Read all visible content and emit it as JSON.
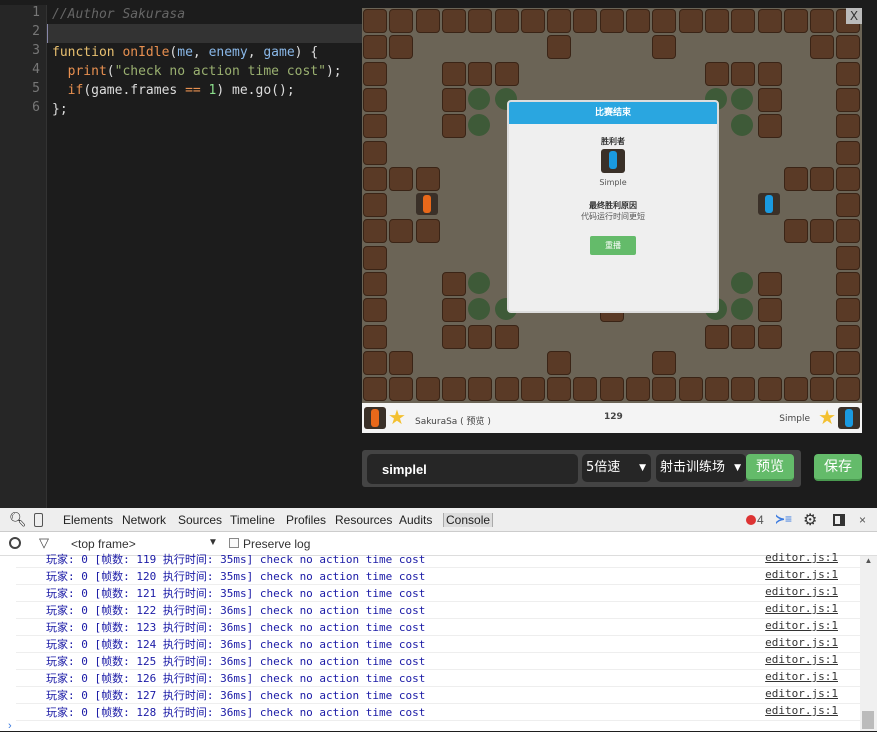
{
  "editor": {
    "line_numbers": [
      "1",
      "2",
      "3",
      "4",
      "5",
      "6"
    ],
    "lines": [
      [
        {
          "t": "//Author Sakurasa",
          "c": "cm"
        }
      ],
      [],
      [
        {
          "t": "function ",
          "c": "kw"
        },
        {
          "t": "onIdle",
          "c": "fn"
        },
        {
          "t": "(",
          "c": ""
        },
        {
          "t": "me",
          "c": "pa"
        },
        {
          "t": ", ",
          "c": ""
        },
        {
          "t": "enemy",
          "c": "pa"
        },
        {
          "t": ", ",
          "c": ""
        },
        {
          "t": "game",
          "c": "pa"
        },
        {
          "t": ") {",
          "c": ""
        }
      ],
      [
        {
          "t": "  ",
          "c": ""
        },
        {
          "t": "print",
          "c": "fn"
        },
        {
          "t": "(",
          "c": ""
        },
        {
          "t": "\"check no action time cost\"",
          "c": "st"
        },
        {
          "t": ");",
          "c": ""
        }
      ],
      [
        {
          "t": "  ",
          "c": ""
        },
        {
          "t": "if",
          "c": "fn"
        },
        {
          "t": "(game.frames ",
          "c": ""
        },
        {
          "t": "==",
          "c": "fn"
        },
        {
          "t": " ",
          "c": ""
        },
        {
          "t": "1",
          "c": "nu"
        },
        {
          "t": ") me.go();",
          "c": ""
        }
      ],
      [
        {
          "t": "};",
          "c": ""
        }
      ]
    ]
  },
  "game": {
    "close": "X",
    "dialog": {
      "title": "比赛结束",
      "winner_label": "胜利者",
      "winner": "Simple",
      "reason_label": "最终胜利原因",
      "reason": "代码运行时间更短",
      "replay": "重播"
    },
    "status": {
      "player1": "SakuraSa ( 预览 )",
      "frame": "129",
      "player2": "Simple"
    },
    "colors": {
      "player1_tank": "#e8681a",
      "player2_tank": "#1a9ae0"
    }
  },
  "controls": {
    "name_value": "simplel",
    "speed": "5倍速",
    "map": "射击训练场",
    "preview": "预览",
    "save": "保存"
  },
  "devtools": {
    "tabs": [
      "Elements",
      "Network",
      "Sources",
      "Timeline",
      "Profiles",
      "Resources",
      "Audits",
      "Console"
    ],
    "active_tab": "Console",
    "error_count": "4",
    "frame": "<top frame>",
    "preserve_log": "Preserve log",
    "logs": [
      {
        "msg": "玩家: 0 [帧数: 119 执行时间: 35ms] check no action time cost",
        "src": "editor.js:1"
      },
      {
        "msg": "玩家: 0 [帧数: 120 执行时间: 35ms] check no action time cost",
        "src": "editor.js:1"
      },
      {
        "msg": "玩家: 0 [帧数: 121 执行时间: 35ms] check no action time cost",
        "src": "editor.js:1"
      },
      {
        "msg": "玩家: 0 [帧数: 122 执行时间: 36ms] check no action time cost",
        "src": "editor.js:1"
      },
      {
        "msg": "玩家: 0 [帧数: 123 执行时间: 36ms] check no action time cost",
        "src": "editor.js:1"
      },
      {
        "msg": "玩家: 0 [帧数: 124 执行时间: 36ms] check no action time cost",
        "src": "editor.js:1"
      },
      {
        "msg": "玩家: 0 [帧数: 125 执行时间: 36ms] check no action time cost",
        "src": "editor.js:1"
      },
      {
        "msg": "玩家: 0 [帧数: 126 执行时间: 36ms] check no action time cost",
        "src": "editor.js:1"
      },
      {
        "msg": "玩家: 0 [帧数: 127 执行时间: 36ms] check no action time cost",
        "src": "editor.js:1"
      },
      {
        "msg": "玩家: 0 [帧数: 128 执行时间: 36ms] check no action time cost",
        "src": "editor.js:1"
      }
    ]
  }
}
